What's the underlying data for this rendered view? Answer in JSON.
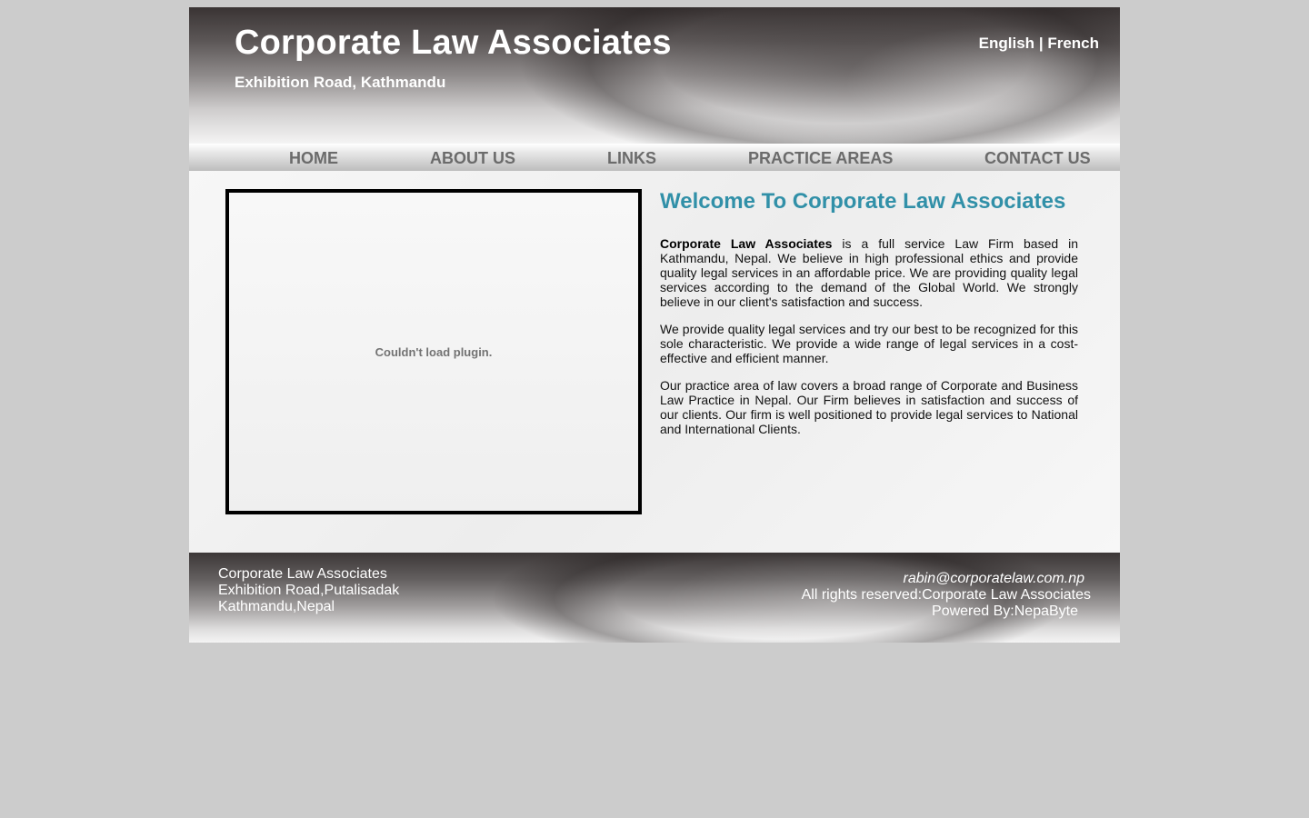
{
  "header": {
    "title": "Corporate Law Associates",
    "subtitle": "Exhibition Road, Kathmandu",
    "languages": {
      "english": "English",
      "separator": "|",
      "french": "French"
    }
  },
  "nav": {
    "items": [
      {
        "label": "HOME"
      },
      {
        "label": "ABOUT US"
      },
      {
        "label": "LINKS"
      },
      {
        "label": "PRACTICE AREAS"
      },
      {
        "label": "CONTACT US"
      }
    ]
  },
  "main": {
    "plugin_message": "Couldn't load plugin.",
    "welcome_title": "Welcome To Corporate Law Associates",
    "paragraph1_bold": "Corporate Law Associates",
    "paragraph1_rest": " is a full service Law Firm based in Kathmandu, Nepal. We believe in high professional ethics and provide quality legal services in an affordable price. We are providing quality legal services according to the demand of the Global World. We strongly believe in our client's satisfaction and success.",
    "paragraph2": "We provide quality legal services and try our best to be recognized for this sole characteristic. We provide a wide range of legal services in a cost-effective and efficient manner.",
    "paragraph3": "Our practice area of law covers a broad range of Corporate and Business Law Practice in Nepal. Our Firm believes in satisfaction and success of our clients. Our firm is well positioned to provide legal services to National and International Clients."
  },
  "footer": {
    "address_lines": [
      "Corporate Law Associates",
      "Exhibition Road,Putalisadak",
      "Kathmandu,Nepal"
    ],
    "email": "rabin@corporatelaw.com.np",
    "rights": "All rights reserved:Corporate Law Associates",
    "powered_prefix": "Powered By:",
    "powered_by": "NepaByte"
  },
  "colors": {
    "page_background": "#cccccc",
    "accent_title": "#3190a8",
    "nav_text": "#6b6b6b",
    "header_text": "#ffffff"
  }
}
